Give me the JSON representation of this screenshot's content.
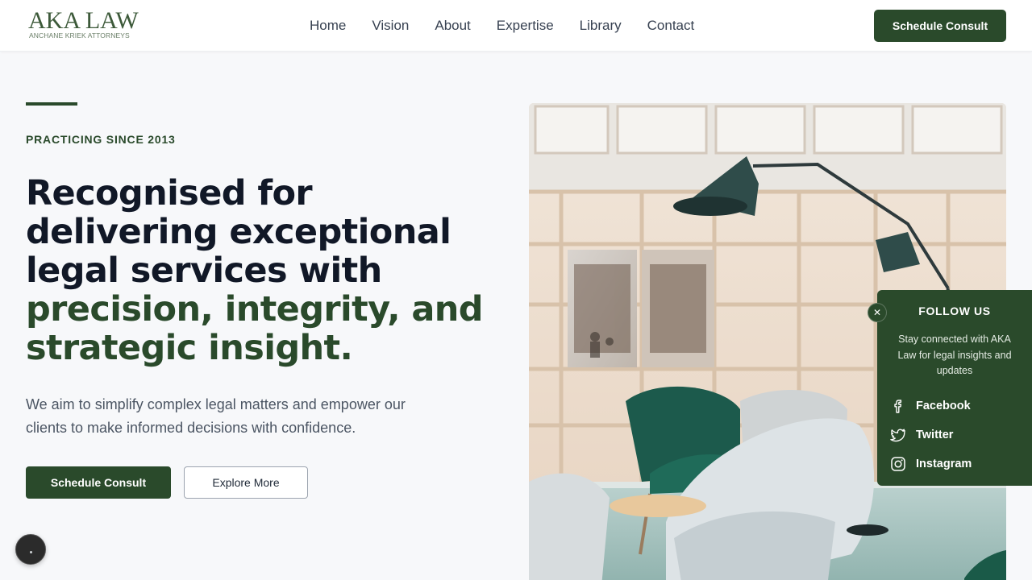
{
  "brand": {
    "name": "AKA LAW",
    "tagline": "ANCHANE KRIEK ATTORNEYS",
    "primary_color": "#2a4a2b",
    "text_color": "#111827"
  },
  "nav": {
    "items": [
      {
        "label": "Home"
      },
      {
        "label": "Vision"
      },
      {
        "label": "About"
      },
      {
        "label": "Expertise"
      },
      {
        "label": "Library"
      },
      {
        "label": "Contact"
      }
    ],
    "cta_label": "Schedule Consult"
  },
  "hero": {
    "eyebrow": "PRACTICING SINCE 2013",
    "headline_main": "Recognised for delivering exceptional legal services with ",
    "headline_accent": "precision, integrity, and strategic insight.",
    "description": "We aim to simplify complex legal matters and empower our clients to make informed decisions with confidence.",
    "primary_button": "Schedule Consult",
    "secondary_button": "Explore More",
    "image_icon": "office-interior-photo"
  },
  "follow": {
    "title": "FOLLOW US",
    "description": "Stay connected with AKA Law for legal insights and updates",
    "close_icon": "close-icon",
    "links": [
      {
        "label": "Facebook",
        "icon": "facebook-icon"
      },
      {
        "label": "Twitter",
        "icon": "twitter-icon"
      },
      {
        "label": "Instagram",
        "icon": "instagram-icon"
      }
    ]
  },
  "chat": {
    "icon": "chat-bubble-icon"
  }
}
